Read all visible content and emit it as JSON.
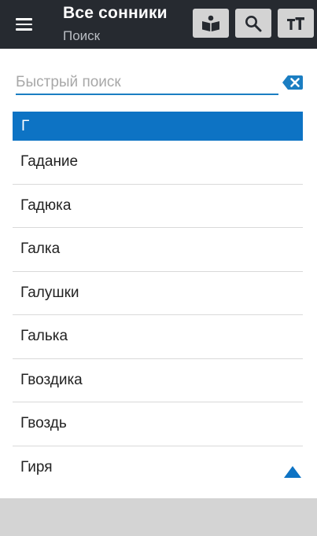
{
  "app_bar": {
    "title": "Все сонники",
    "subtitle": "Поиск",
    "buttons": [
      {
        "name": "book-button",
        "icon": "open-book-icon"
      },
      {
        "name": "search-button",
        "icon": "search-icon"
      },
      {
        "name": "font-size-button",
        "icon": "text-size-icon"
      }
    ]
  },
  "search": {
    "placeholder": "Быстрый поиск",
    "value": "",
    "clear_icon": "backspace-clear-icon"
  },
  "list": {
    "section_header": "Г",
    "items": [
      "Гадание",
      "Гадюка",
      "Галка",
      "Галушки",
      "Галька",
      "Гвоздика",
      "Гвоздь",
      "Гиря"
    ]
  },
  "scroll_up_icon": "triangle-up-icon",
  "colors": {
    "appbar": "#262a30",
    "accent": "#0d73c4",
    "button_bg": "#d3d3d3",
    "divider": "#d9d9d9"
  }
}
